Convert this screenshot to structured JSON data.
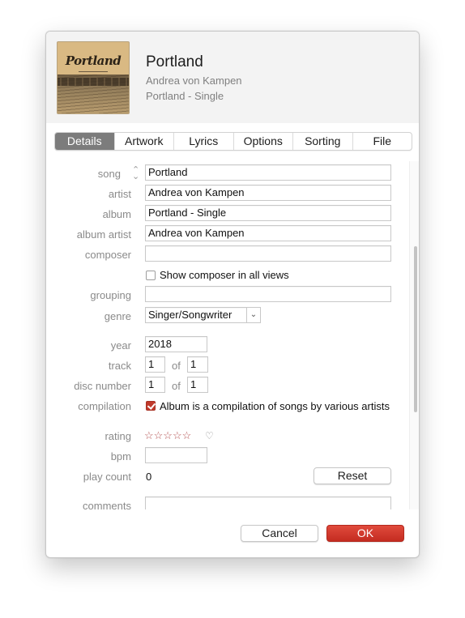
{
  "header": {
    "title": "Portland",
    "artist": "Andrea von Kampen",
    "album": "Portland - Single",
    "artwork_text": "Portland"
  },
  "tabs": [
    {
      "label": "Details",
      "active": true
    },
    {
      "label": "Artwork",
      "active": false
    },
    {
      "label": "Lyrics",
      "active": false
    },
    {
      "label": "Options",
      "active": false
    },
    {
      "label": "Sorting",
      "active": false
    },
    {
      "label": "File",
      "active": false
    }
  ],
  "details": {
    "song": {
      "label": "song",
      "value": "Portland",
      "stepper_icon": "up-down-chevron-icon"
    },
    "artist": {
      "label": "artist",
      "value": "Andrea von Kampen"
    },
    "album": {
      "label": "album",
      "value": "Portland - Single"
    },
    "album_artist": {
      "label": "album artist",
      "value": "Andrea von Kampen"
    },
    "composer": {
      "label": "composer",
      "value": ""
    },
    "show_composer": {
      "label": "Show composer in all views",
      "checked": false
    },
    "grouping": {
      "label": "grouping",
      "value": ""
    },
    "genre": {
      "label": "genre",
      "value": "Singer/Songwriter"
    },
    "year": {
      "label": "year",
      "value": "2018"
    },
    "track": {
      "label": "track",
      "number": "1",
      "of_label": "of",
      "total": "1"
    },
    "disc": {
      "label": "disc number",
      "number": "1",
      "of_label": "of",
      "total": "1"
    },
    "compilation": {
      "label": "compilation",
      "text": "Album is a compilation of songs by various artists",
      "checked": true
    },
    "rating": {
      "label": "rating",
      "stars": 0,
      "max_stars": 5,
      "star_glyphs": "☆☆☆☆☆",
      "loved": false,
      "heart_glyph": "♡"
    },
    "bpm": {
      "label": "bpm",
      "value": ""
    },
    "play_count": {
      "label": "play count",
      "value": "0",
      "reset_label": "Reset"
    },
    "comments": {
      "label": "comments",
      "value": ""
    }
  },
  "footer": {
    "cancel_label": "Cancel",
    "ok_label": "OK"
  },
  "colors": {
    "accent": "#c42c21",
    "active_tab": "#7c7c7c",
    "label_gray": "#8a8a8a"
  }
}
